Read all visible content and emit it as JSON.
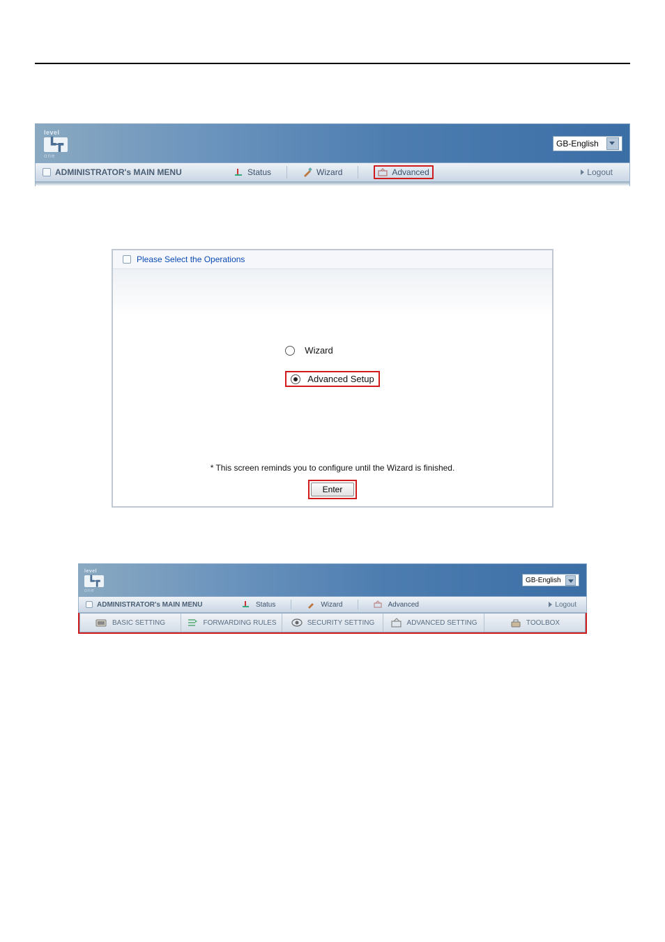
{
  "logo": {
    "brand": "level",
    "tag": "one"
  },
  "langSelect": "GB-English",
  "nav": {
    "mainMenu": "ADMINISTRATOR's MAIN MENU",
    "status": "Status",
    "wizard": "Wizard",
    "advanced": "Advanced",
    "logout": "Logout"
  },
  "panel": {
    "header": "Please Select the Operations",
    "option_wizard": "Wizard",
    "option_advanced": "Advanced Setup",
    "note": "* This screen reminds you to configure until the Wizard is finished.",
    "enter": "Enter"
  },
  "subnav": {
    "basic": "BASIC SETTING",
    "forwarding": "FORWARDING RULES",
    "security": "SECURITY SETTING",
    "advanced": "ADVANCED SETTING",
    "toolbox": "TOOLBOX"
  }
}
